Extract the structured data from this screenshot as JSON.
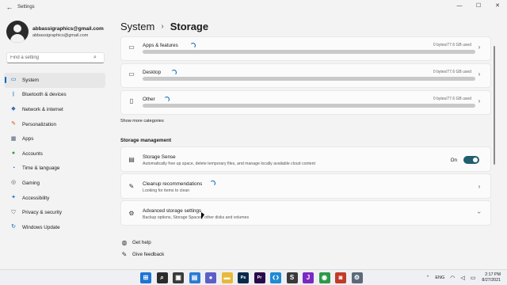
{
  "window": {
    "title": "Settings",
    "back_icon": "back-arrow-icon",
    "controls": [
      "minimize-icon",
      "maximize-icon",
      "close-icon"
    ]
  },
  "profile": {
    "name": "abbassigraphics@gmail.com",
    "email": "abbassigraphics@gmail.com"
  },
  "search": {
    "placeholder": "Find a setting"
  },
  "sidebar": {
    "items": [
      {
        "label": "System",
        "icon": "system-monitor-icon",
        "color": "#0067c0",
        "active": true
      },
      {
        "label": "Bluetooth & devices",
        "icon": "bluetooth-icon",
        "color": "#0067c0"
      },
      {
        "label": "Network & internet",
        "icon": "network-icon",
        "color": "#3b6fb6"
      },
      {
        "label": "Personalization",
        "icon": "paint-brush-icon",
        "color": "#c25a1a"
      },
      {
        "label": "Apps",
        "icon": "apps-icon",
        "color": "#4a5a72"
      },
      {
        "label": "Accounts",
        "icon": "accounts-icon",
        "color": "#2d9c4d"
      },
      {
        "label": "Time & language",
        "icon": "globe-clock-icon",
        "color": "#0067c0"
      },
      {
        "label": "Gaming",
        "icon": "gaming-controller-icon",
        "color": "#555555"
      },
      {
        "label": "Accessibility",
        "icon": "accessibility-icon",
        "color": "#1a73c8"
      },
      {
        "label": "Privacy & security",
        "icon": "shield-icon",
        "color": "#6a6a6a"
      },
      {
        "label": "Windows Update",
        "icon": "windows-update-icon",
        "color": "#0067c0"
      }
    ]
  },
  "breadcrumb": {
    "parent": "System",
    "separator": "›",
    "current": "Storage"
  },
  "storage_categories": [
    {
      "label": "Apps & features",
      "size": "0 bytes/77.6 GB used",
      "icon": "apps-features-icon"
    },
    {
      "label": "Desktop",
      "size": "0 bytes/77.6 GB used",
      "icon": "desktop-icon"
    },
    {
      "label": "Other",
      "size": "0 bytes/77.6 GB used",
      "icon": "folder-icon"
    }
  ],
  "show_more": "Show more categories",
  "management": {
    "title": "Storage management",
    "items": [
      {
        "label": "Storage Sense",
        "desc": "Automatically free up space, delete temporary files, and manage locally available cloud content",
        "icon": "storage-sense-icon",
        "toggle": "On"
      },
      {
        "label": "Cleanup recommendations",
        "desc": "Looking for items to clean",
        "icon": "cleanup-broom-icon"
      },
      {
        "label": "Advanced storage settings",
        "desc": "Backup options, Storage Spaces, other disks and volumes",
        "icon": "gear-icon"
      }
    ]
  },
  "links": [
    {
      "label": "Get help",
      "icon": "help-icon"
    },
    {
      "label": "Give feedback",
      "icon": "feedback-icon"
    }
  ],
  "taskbar": {
    "apps": [
      {
        "name": "start-icon",
        "color": "#1e74d6",
        "glyph": "⊞"
      },
      {
        "name": "search-icon",
        "color": "#2b2b2b",
        "glyph": "⌕"
      },
      {
        "name": "task-view-icon",
        "color": "#3a3a3a",
        "glyph": "▣"
      },
      {
        "name": "widgets-icon",
        "color": "#2a7bd4",
        "glyph": "▤"
      },
      {
        "name": "chat-icon",
        "color": "#5b5fc7",
        "glyph": "●"
      },
      {
        "name": "file-explorer-icon",
        "color": "#e8b93a",
        "glyph": "▬"
      },
      {
        "name": "photoshop-icon",
        "color": "#0a2a4a",
        "glyph": "Ps"
      },
      {
        "name": "premiere-icon",
        "color": "#2a0a4a",
        "glyph": "Pr"
      },
      {
        "name": "vscode-icon",
        "color": "#1e8ad4",
        "glyph": "❮❯"
      },
      {
        "name": "sublime-icon",
        "color": "#3a3a3a",
        "glyph": "S"
      },
      {
        "name": "jetbrains-icon",
        "color": "#7a2ac2",
        "glyph": "J"
      },
      {
        "name": "chrome-icon",
        "color": "#2c9a4a",
        "glyph": "◉"
      },
      {
        "name": "screen-recorder-icon",
        "color": "#c23a2a",
        "glyph": "◙"
      },
      {
        "name": "settings-icon",
        "color": "#5a6a7a",
        "glyph": "⚙",
        "active": true
      }
    ],
    "tray": {
      "chevron": "tray-chevron-icon",
      "language": "ENG",
      "wifi_icon": "wifi-icon",
      "volume_icon": "volume-icon",
      "battery_icon": "battery-icon",
      "time": "2:17 PM",
      "date": "8/27/2021"
    }
  }
}
